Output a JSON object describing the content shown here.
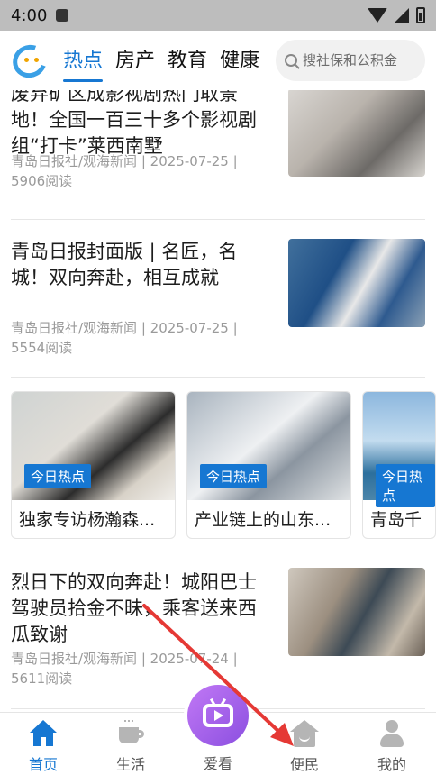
{
  "status_bar": {
    "time": "4:00"
  },
  "header": {
    "tabs": [
      {
        "label": "热点",
        "active": true
      },
      {
        "label": "房产",
        "active": false
      },
      {
        "label": "教育",
        "active": false
      },
      {
        "label": "健康",
        "active": false
      }
    ],
    "search_placeholder": "搜社保和公积金"
  },
  "articles": [
    {
      "title": "废弃矿区成影视剧热门取景地！全国一百三十多个影视剧组“打卡”莱西南墅",
      "source": "青岛日报社/观海新闻 | 2025-07-25 | 5906阅读"
    },
    {
      "title": "青岛日报封面版 | 名匠，名城！双向奔赴，相互成就",
      "source": "青岛日报社/观海新闻 | 2025-07-25 | 5554阅读"
    },
    {
      "title": "烈日下的双向奔赴！城阳巴士驾驶员拾金不昧，乘客送来西瓜致谢",
      "source": "青岛日报社/观海新闻 | 2025-07-24 | 5611阅读"
    }
  ],
  "hot_cards": [
    {
      "badge": "今日热点",
      "caption": "独家专访杨瀚森..."
    },
    {
      "badge": "今日热点",
      "caption": "产业链上的山东..."
    },
    {
      "badge": "今日热点",
      "caption": "青岛千"
    }
  ],
  "bottom_nav": [
    {
      "label": "首页",
      "icon": "home-icon",
      "active": true
    },
    {
      "label": "生活",
      "icon": "cup-icon",
      "active": false
    },
    {
      "label": "爱看",
      "icon": "tv-play-icon",
      "active": false
    },
    {
      "label": "便民",
      "icon": "house-smile-icon",
      "active": false
    },
    {
      "label": "我的",
      "icon": "user-icon",
      "active": false
    }
  ],
  "colors": {
    "accent": "#1677d2",
    "center_button": "#a463ec",
    "annotation_arrow": "#e53935"
  }
}
